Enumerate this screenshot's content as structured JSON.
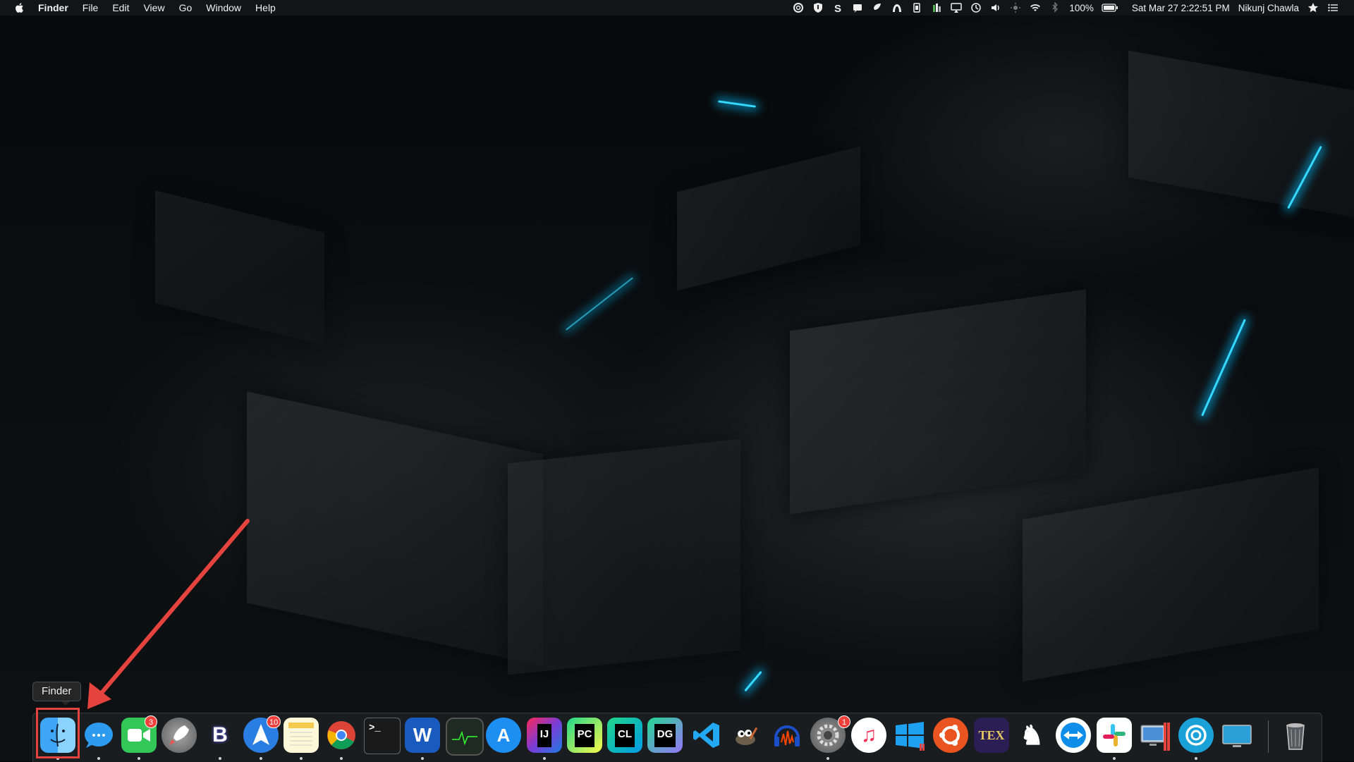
{
  "menubar": {
    "app_name": "Finder",
    "menus": [
      "File",
      "Edit",
      "View",
      "Go",
      "Window",
      "Help"
    ],
    "battery": "100%",
    "clock": "Sat Mar 27  2:22:51 PM",
    "user": "Nikunj Chawla",
    "status_icons": [
      "grammarly-icon",
      "shield-icon",
      "s-icon",
      "notification-icon",
      "diamond-icon",
      "arch-icon",
      "cpu-icon",
      "memory-icon",
      "airplay-icon",
      "time-machine-icon",
      "volume-icon",
      "brightness-icon",
      "wifi-icon",
      "bluetooth-icon",
      "battery-icon",
      "star-icon",
      "list-icon"
    ]
  },
  "tooltip": "Finder",
  "dock": {
    "apps": [
      {
        "name": "finder",
        "label": "",
        "badge": ""
      },
      {
        "name": "messages",
        "label": "",
        "badge": ""
      },
      {
        "name": "facetime",
        "label": "",
        "badge": "3"
      },
      {
        "name": "launchpad",
        "label": "",
        "badge": ""
      },
      {
        "name": "bbedit",
        "label": "B",
        "badge": ""
      },
      {
        "name": "spark",
        "label": "",
        "badge": "10"
      },
      {
        "name": "notes",
        "label": "",
        "badge": ""
      },
      {
        "name": "chrome",
        "label": "",
        "badge": ""
      },
      {
        "name": "terminal",
        "label": ">_",
        "badge": ""
      },
      {
        "name": "word",
        "label": "W",
        "badge": ""
      },
      {
        "name": "activity-monitor",
        "label": "",
        "badge": ""
      },
      {
        "name": "app-store",
        "label": "A",
        "badge": ""
      },
      {
        "name": "intellij",
        "label": "IJ",
        "badge": ""
      },
      {
        "name": "pycharm",
        "label": "PC",
        "badge": ""
      },
      {
        "name": "clion",
        "label": "CL",
        "badge": ""
      },
      {
        "name": "datagrip",
        "label": "DG",
        "badge": ""
      },
      {
        "name": "vscode",
        "label": "",
        "badge": ""
      },
      {
        "name": "gimp",
        "label": "",
        "badge": ""
      },
      {
        "name": "audacity",
        "label": "",
        "badge": ""
      },
      {
        "name": "system-preferences",
        "label": "",
        "badge": "1"
      },
      {
        "name": "music",
        "label": "♫",
        "badge": ""
      },
      {
        "name": "windows-vm",
        "label": "",
        "badge": ""
      },
      {
        "name": "ubuntu-vm",
        "label": "",
        "badge": ""
      },
      {
        "name": "texshop",
        "label": "TEX",
        "badge": ""
      },
      {
        "name": "chess",
        "label": "♞",
        "badge": ""
      },
      {
        "name": "teamviewer",
        "label": "",
        "badge": ""
      },
      {
        "name": "slack",
        "label": "",
        "badge": ""
      },
      {
        "name": "parallels",
        "label": "",
        "badge": ""
      },
      {
        "name": "grammarly",
        "label": "",
        "badge": ""
      },
      {
        "name": "screen",
        "label": "",
        "badge": ""
      },
      {
        "name": "trash",
        "label": "",
        "badge": ""
      }
    ]
  },
  "colors": {
    "annotation": "#e5433e",
    "accent": "#35d9ff"
  }
}
